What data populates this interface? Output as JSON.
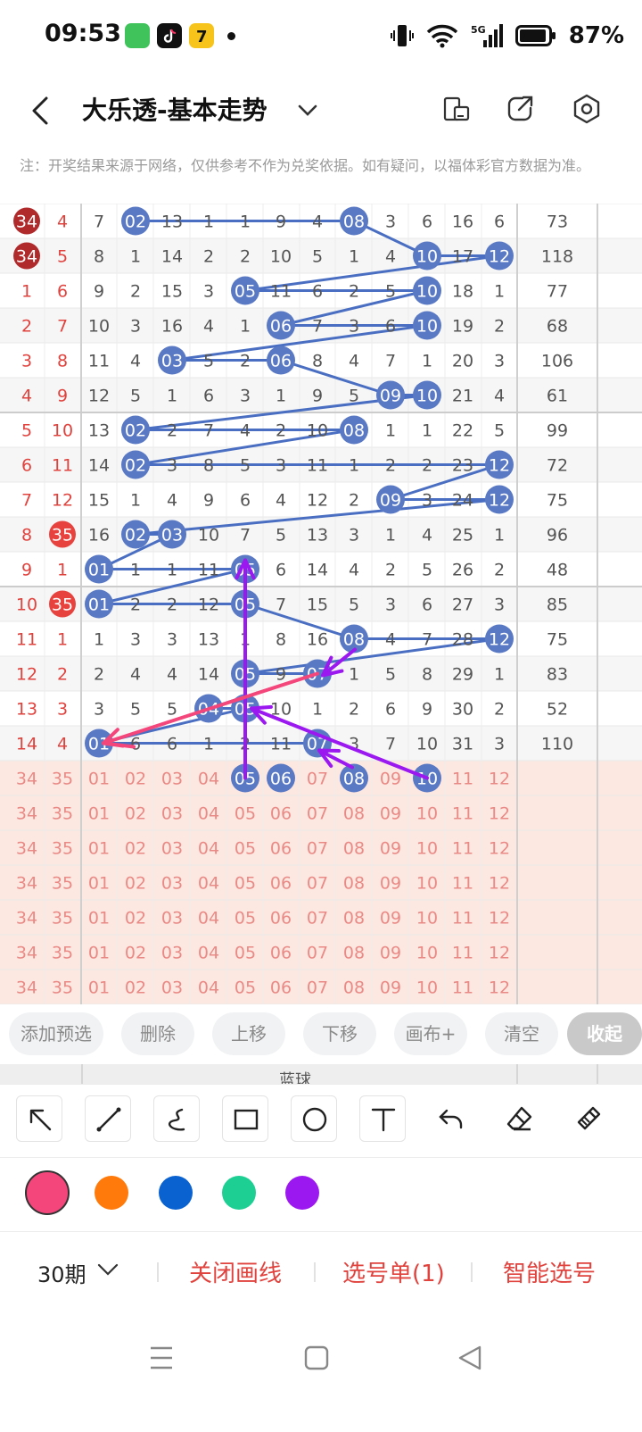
{
  "status_bar": {
    "time": "09:53",
    "battery": "87%",
    "network": "5G"
  },
  "header": {
    "title": "大乐透-基本走势"
  },
  "notice": "注：开奖结果来源于网络，仅供参考不作为兑奖依据。如有疑问，以福体彩官方数据为准。",
  "chart_data": {
    "type": "table",
    "colors": {
      "ball": "#5a79c5",
      "line": "#4a6fc2",
      "red_ball": "#b0292b",
      "red_text": "#e0433e",
      "pink_row": "#fde8e1",
      "blue_text": "#e98a86"
    },
    "rows": [
      {
        "a": "34",
        "b": "4",
        "c": [
          "7",
          "02",
          "13",
          "1",
          "1",
          "9",
          "4",
          "08",
          "3",
          "6",
          "16",
          "6"
        ],
        "s": "73",
        "ar": true,
        "balls": [
          1,
          7
        ]
      },
      {
        "a": "34",
        "b": "5",
        "c": [
          "8",
          "1",
          "14",
          "2",
          "2",
          "10",
          "5",
          "1",
          "4",
          "10",
          "17",
          "12"
        ],
        "s": "118",
        "ar": true,
        "balls": [
          9,
          11
        ]
      },
      {
        "a": "1",
        "b": "6",
        "c": [
          "9",
          "2",
          "15",
          "3",
          "05",
          "11",
          "6",
          "2",
          "5",
          "10",
          "18",
          "1"
        ],
        "s": "77",
        "balls": [
          4,
          9
        ]
      },
      {
        "a": "2",
        "b": "7",
        "c": [
          "10",
          "3",
          "16",
          "4",
          "1",
          "06",
          "7",
          "3",
          "6",
          "10",
          "19",
          "2"
        ],
        "s": "68",
        "balls": [
          5,
          9
        ]
      },
      {
        "a": "3",
        "b": "8",
        "c": [
          "11",
          "4",
          "03",
          "5",
          "2",
          "06",
          "8",
          "4",
          "7",
          "1",
          "20",
          "3"
        ],
        "s": "106",
        "balls": [
          2,
          5
        ]
      },
      {
        "a": "4",
        "b": "9",
        "c": [
          "12",
          "5",
          "1",
          "6",
          "3",
          "1",
          "9",
          "5",
          "09",
          "10",
          "21",
          "4"
        ],
        "s": "61",
        "balls": [
          8,
          9
        ]
      },
      {
        "a": "5",
        "b": "10",
        "c": [
          "13",
          "02",
          "2",
          "7",
          "4",
          "2",
          "10",
          "08",
          "1",
          "1",
          "22",
          "5"
        ],
        "s": "99",
        "balls": [
          1,
          7
        ]
      },
      {
        "a": "6",
        "b": "11",
        "c": [
          "14",
          "02",
          "3",
          "8",
          "5",
          "3",
          "11",
          "1",
          "2",
          "2",
          "23",
          "12"
        ],
        "s": "72",
        "balls": [
          1,
          11
        ]
      },
      {
        "a": "7",
        "b": "12",
        "c": [
          "15",
          "1",
          "4",
          "9",
          "6",
          "4",
          "12",
          "2",
          "09",
          "3",
          "24",
          "12"
        ],
        "s": "75",
        "balls": [
          8,
          11
        ]
      },
      {
        "a": "8",
        "b": "35",
        "c": [
          "16",
          "02",
          "03",
          "10",
          "7",
          "5",
          "13",
          "3",
          "1",
          "4",
          "25",
          "1"
        ],
        "s": "96",
        "br": true,
        "balls": [
          1,
          2
        ]
      },
      {
        "a": "9",
        "b": "1",
        "c": [
          "01",
          "1",
          "1",
          "11",
          "05",
          "6",
          "14",
          "4",
          "2",
          "5",
          "26",
          "2"
        ],
        "s": "48",
        "balls": [
          0,
          4
        ]
      },
      {
        "a": "10",
        "b": "35",
        "c": [
          "01",
          "2",
          "2",
          "12",
          "05",
          "7",
          "15",
          "5",
          "3",
          "6",
          "27",
          "3"
        ],
        "s": "85",
        "br": true,
        "balls": [
          0,
          4
        ]
      },
      {
        "a": "11",
        "b": "1",
        "c": [
          "1",
          "3",
          "3",
          "13",
          "1",
          "8",
          "16",
          "08",
          "4",
          "7",
          "28",
          "12"
        ],
        "s": "75",
        "balls": [
          7,
          11
        ]
      },
      {
        "a": "12",
        "b": "2",
        "c": [
          "2",
          "4",
          "4",
          "14",
          "05",
          "9",
          "07",
          "1",
          "5",
          "8",
          "29",
          "1"
        ],
        "s": "83",
        "balls": [
          4,
          6
        ]
      },
      {
        "a": "13",
        "b": "3",
        "c": [
          "3",
          "5",
          "5",
          "04",
          "05",
          "10",
          "1",
          "2",
          "6",
          "9",
          "30",
          "2"
        ],
        "s": "52",
        "balls": [
          3,
          4
        ]
      },
      {
        "a": "14",
        "b": "4",
        "c": [
          "01",
          "6",
          "6",
          "1",
          "2",
          "11",
          "07",
          "3",
          "7",
          "10",
          "31",
          "3"
        ],
        "s": "110",
        "balls": [
          0,
          6
        ]
      }
    ],
    "pick_rows": [
      {
        "a": "34",
        "b": "35",
        "c": [
          "01",
          "02",
          "03",
          "04",
          "05",
          "06",
          "07",
          "08",
          "09",
          "10",
          "11",
          "12"
        ],
        "balls": [
          4,
          5,
          7,
          9
        ]
      },
      {
        "a": "34",
        "b": "35",
        "c": [
          "01",
          "02",
          "03",
          "04",
          "05",
          "06",
          "07",
          "08",
          "09",
          "10",
          "11",
          "12"
        ],
        "balls": []
      },
      {
        "a": "34",
        "b": "35",
        "c": [
          "01",
          "02",
          "03",
          "04",
          "05",
          "06",
          "07",
          "08",
          "09",
          "10",
          "11",
          "12"
        ],
        "balls": []
      },
      {
        "a": "34",
        "b": "35",
        "c": [
          "01",
          "02",
          "03",
          "04",
          "05",
          "06",
          "07",
          "08",
          "09",
          "10",
          "11",
          "12"
        ],
        "balls": []
      },
      {
        "a": "34",
        "b": "35",
        "c": [
          "01",
          "02",
          "03",
          "04",
          "05",
          "06",
          "07",
          "08",
          "09",
          "10",
          "11",
          "12"
        ],
        "balls": []
      },
      {
        "a": "34",
        "b": "35",
        "c": [
          "01",
          "02",
          "03",
          "04",
          "05",
          "06",
          "07",
          "08",
          "09",
          "10",
          "11",
          "12"
        ],
        "balls": []
      },
      {
        "a": "34",
        "b": "35",
        "c": [
          "01",
          "02",
          "03",
          "04",
          "05",
          "06",
          "07",
          "08",
          "09",
          "10",
          "11",
          "12"
        ],
        "balls": []
      }
    ]
  },
  "actions": [
    "添加预选",
    "删除",
    "上移",
    "下移",
    "画布+",
    "清空",
    "收起"
  ],
  "section_label": "蓝球",
  "tools": [
    "arrow-tool",
    "line-tool",
    "curve-tool",
    "rect-tool",
    "circle-tool",
    "text-tool",
    "undo-tool",
    "eraser-tool",
    "clear-brush-tool"
  ],
  "palette": [
    "#f4467a",
    "#ff7a0a",
    "#0a62d1",
    "#1ecf93",
    "#9b19f0"
  ],
  "footer": {
    "period": "30期",
    "close_draw": "关闭画线",
    "selection": "选号单(1)",
    "smart_pick": "智能选号"
  }
}
